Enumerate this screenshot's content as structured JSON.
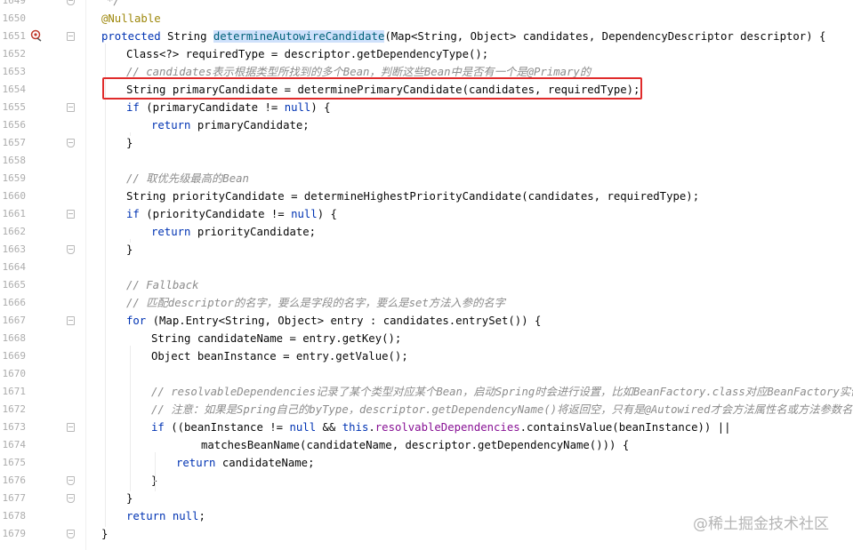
{
  "editor": {
    "lines": [
      {
        "num": "1649",
        "segments": [
          {
            "cls": "cmt",
            "text": "*/"
          }
        ],
        "indent": 120
      },
      {
        "num": "1650",
        "segments": [
          {
            "cls": "ann",
            "text": "@Nullable"
          }
        ],
        "indent": 114
      },
      {
        "num": "1651",
        "segments": [
          {
            "cls": "kw",
            "text": "protected "
          },
          {
            "cls": "",
            "text": "String "
          },
          {
            "cls": "hl",
            "text": "determineAutowireCandidate"
          },
          {
            "cls": "",
            "text": "(Map<String, Object> candidates, DependencyDescriptor descriptor) {"
          }
        ],
        "indent": 114
      },
      {
        "num": "1652",
        "segments": [
          {
            "cls": "",
            "text": "Class<?> requiredType = descriptor.getDependencyType();"
          }
        ],
        "indent": 142
      },
      {
        "num": "1653",
        "segments": [
          {
            "cls": "cmt",
            "text": "// candidates表示根据类型所找到的多个Bean，判断这些Bean中是否有一个是@Primary的"
          }
        ],
        "indent": 142
      },
      {
        "num": "1654",
        "segments": [
          {
            "cls": "",
            "text": "String primaryCandidate = determinePrimaryCandidate(candidates, requiredType);"
          }
        ],
        "indent": 142
      },
      {
        "num": "1655",
        "segments": [
          {
            "cls": "kw",
            "text": "if "
          },
          {
            "cls": "",
            "text": "(primaryCandidate != "
          },
          {
            "cls": "kw",
            "text": "null"
          },
          {
            "cls": "",
            "text": ") {"
          }
        ],
        "indent": 142
      },
      {
        "num": "1656",
        "segments": [
          {
            "cls": "kw",
            "text": "return "
          },
          {
            "cls": "",
            "text": "primaryCandidate;"
          }
        ],
        "indent": 170
      },
      {
        "num": "1657",
        "segments": [
          {
            "cls": "",
            "text": "}"
          }
        ],
        "indent": 142
      },
      {
        "num": "1658",
        "segments": [],
        "indent": 142
      },
      {
        "num": "1659",
        "segments": [
          {
            "cls": "cmt",
            "text": "// 取优先级最高的Bean"
          }
        ],
        "indent": 142
      },
      {
        "num": "1660",
        "segments": [
          {
            "cls": "",
            "text": "String priorityCandidate = determineHighestPriorityCandidate(candidates, requiredType);"
          }
        ],
        "indent": 142
      },
      {
        "num": "1661",
        "segments": [
          {
            "cls": "kw",
            "text": "if "
          },
          {
            "cls": "",
            "text": "(priorityCandidate != "
          },
          {
            "cls": "kw",
            "text": "null"
          },
          {
            "cls": "",
            "text": ") {"
          }
        ],
        "indent": 142
      },
      {
        "num": "1662",
        "segments": [
          {
            "cls": "kw",
            "text": "return "
          },
          {
            "cls": "",
            "text": "priorityCandidate;"
          }
        ],
        "indent": 170
      },
      {
        "num": "1663",
        "segments": [
          {
            "cls": "",
            "text": "}"
          }
        ],
        "indent": 142
      },
      {
        "num": "1664",
        "segments": [],
        "indent": 142
      },
      {
        "num": "1665",
        "segments": [
          {
            "cls": "cmt",
            "text": "// Fallback"
          }
        ],
        "indent": 142
      },
      {
        "num": "1666",
        "segments": [
          {
            "cls": "cmt",
            "text": "// 匹配descriptor的名字，要么是字段的名字，要么是set方法入参的名字"
          }
        ],
        "indent": 142
      },
      {
        "num": "1667",
        "segments": [
          {
            "cls": "kw",
            "text": "for "
          },
          {
            "cls": "",
            "text": "(Map.Entry<String, Object> entry : candidates.entrySet()) {"
          }
        ],
        "indent": 142
      },
      {
        "num": "1668",
        "segments": [
          {
            "cls": "",
            "text": "String candidateName = entry.getKey();"
          }
        ],
        "indent": 170
      },
      {
        "num": "1669",
        "segments": [
          {
            "cls": "",
            "text": "Object beanInstance = entry.getValue();"
          }
        ],
        "indent": 170
      },
      {
        "num": "1670",
        "segments": [],
        "indent": 170
      },
      {
        "num": "1671",
        "segments": [
          {
            "cls": "cmt",
            "text": "// resolvableDependencies记录了某个类型对应某个Bean，启动Spring时会进行设置，比如BeanFactory.class对应BeanFactory实例"
          }
        ],
        "indent": 170
      },
      {
        "num": "1672",
        "segments": [
          {
            "cls": "cmt",
            "text": "// 注意：如果是Spring自己的byType，descriptor.getDependencyName()将返回空，只有是@Autowired才会方法属性名或方法参数名"
          }
        ],
        "indent": 170
      },
      {
        "num": "1673",
        "segments": [
          {
            "cls": "kw",
            "text": "if "
          },
          {
            "cls": "",
            "text": "((beanInstance != "
          },
          {
            "cls": "kw",
            "text": "null "
          },
          {
            "cls": "",
            "text": "&& "
          },
          {
            "cls": "kw",
            "text": "this"
          },
          {
            "cls": "",
            "text": "."
          },
          {
            "cls": "fld",
            "text": "resolvableDependencies"
          },
          {
            "cls": "",
            "text": ".containsValue(beanInstance)) ||"
          }
        ],
        "indent": 170
      },
      {
        "num": "1674",
        "segments": [
          {
            "cls": "",
            "text": "matchesBeanName(candidateName, descriptor.getDependencyName())) {"
          }
        ],
        "indent": 226
      },
      {
        "num": "1675",
        "segments": [
          {
            "cls": "kw",
            "text": "return "
          },
          {
            "cls": "",
            "text": "candidateName;"
          }
        ],
        "indent": 198
      },
      {
        "num": "1676",
        "segments": [
          {
            "cls": "",
            "text": "}"
          }
        ],
        "indent": 170
      },
      {
        "num": "1677",
        "segments": [
          {
            "cls": "",
            "text": "}"
          }
        ],
        "indent": 142
      },
      {
        "num": "1678",
        "segments": [
          {
            "cls": "kw",
            "text": "return "
          },
          {
            "cls": "kw",
            "text": "null"
          },
          {
            "cls": "",
            "text": ";"
          }
        ],
        "indent": 142
      },
      {
        "num": "1679",
        "segments": [
          {
            "cls": "",
            "text": "}"
          }
        ],
        "indent": 114
      }
    ],
    "folds": {
      "1651": "start",
      "1655": "start",
      "1657": "end",
      "1661": "start",
      "1663": "end",
      "1667": "start",
      "1673": "start",
      "1676": "end",
      "1677": "end",
      "1679": "end",
      "1649": "end"
    },
    "gutter_icon_line": "1651",
    "gutter_icon": "override-method-icon"
  },
  "watermark": "@稀土掘金技术社区",
  "colors": {
    "highlight_box": "#e02b2b",
    "keyword": "#0033b3",
    "comment": "#8c8c8c",
    "annotation": "#9e880d"
  }
}
